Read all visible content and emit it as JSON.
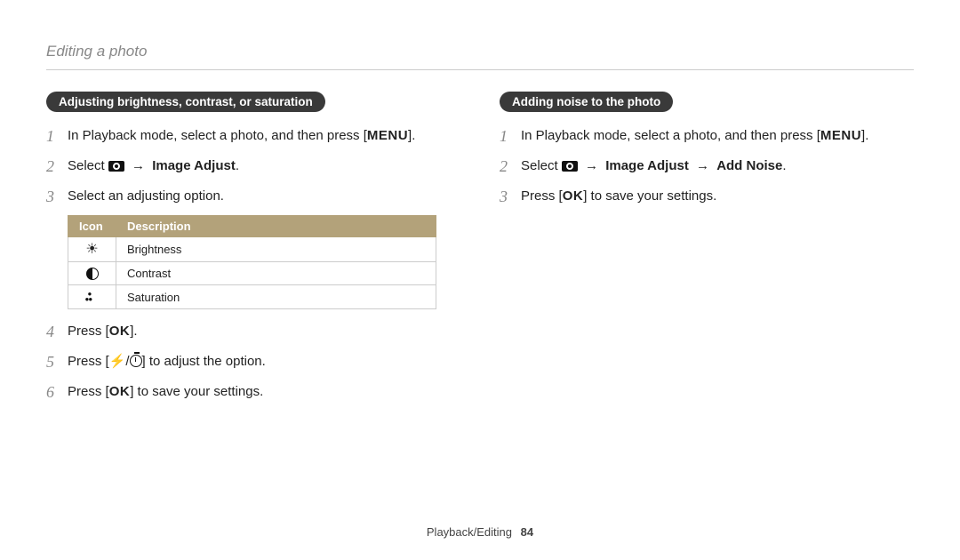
{
  "header": {
    "title": "Editing a photo"
  },
  "left": {
    "pill": "Adjusting brightness, contrast, or saturation",
    "steps": {
      "s1_pre": "In Playback mode, select a photo, and then press [",
      "s1_btn": "MENU",
      "s1_post": "].",
      "s2_pre": "Select ",
      "s2_arrow": "→",
      "s2_bold": "Image Adjust",
      "s2_post": ".",
      "s3": "Select an adjusting option.",
      "s4_pre": "Press [",
      "s4_btn": "OK",
      "s4_post": "].",
      "s5_pre": "Press [",
      "s5_flash": "⚡",
      "s5_slash": "/",
      "s5_post": "] to adjust the option.",
      "s6_pre": "Press [",
      "s6_btn": "OK",
      "s6_post": "] to save your settings."
    },
    "table": {
      "h1": "Icon",
      "h2": "Description",
      "r1": "Brightness",
      "r2": "Contrast",
      "r3": "Saturation"
    }
  },
  "right": {
    "pill": "Adding noise to the photo",
    "steps": {
      "s1_pre": "In Playback mode, select a photo, and then press [",
      "s1_btn": "MENU",
      "s1_post": "].",
      "s2_pre": "Select ",
      "s2_arrow1": "→",
      "s2_bold1": "Image Adjust",
      "s2_arrow2": "→",
      "s2_bold2": "Add Noise",
      "s2_post": ".",
      "s3_pre": "Press [",
      "s3_btn": "OK",
      "s3_post": "] to save your settings."
    }
  },
  "footer": {
    "section": "Playback/Editing",
    "page": "84"
  },
  "nums": {
    "n1": "1",
    "n2": "2",
    "n3": "3",
    "n4": "4",
    "n5": "5",
    "n6": "6"
  }
}
